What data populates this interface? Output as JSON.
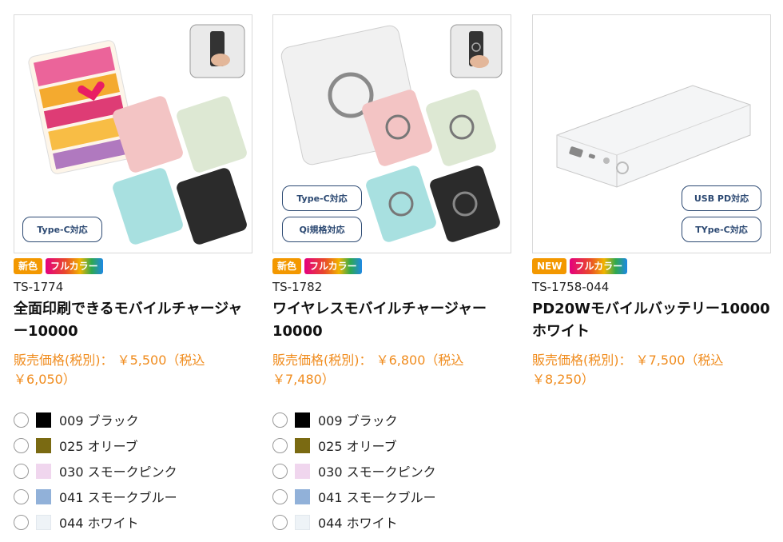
{
  "products": [
    {
      "badges": [
        "新色",
        "フルカラー"
      ],
      "code": "TS-1774",
      "title": "全面印刷できるモバイルチャージャー10000",
      "price": "販売価格(税別)： ￥5,500（税込￥6,050）",
      "tags": [
        "Type-C対応"
      ],
      "colors": [
        {
          "label": "009 ブラック",
          "hex": "#000000"
        },
        {
          "label": "025 オリーブ",
          "hex": "#7a6a12"
        },
        {
          "label": "030 スモークピンク",
          "hex": "#f0d6ee"
        },
        {
          "label": "041 スモークブルー",
          "hex": "#91b1d9"
        },
        {
          "label": "044 ホワイト",
          "hex": "#eef3f7"
        }
      ]
    },
    {
      "badges": [
        "新色",
        "フルカラー"
      ],
      "code": "TS-1782",
      "title": "ワイヤレスモバイルチャージャー10000",
      "price": "販売価格(税別)： ￥6,800（税込￥7,480）",
      "tags": [
        "Type-C対応",
        "Qi規格対応"
      ],
      "colors": [
        {
          "label": "009 ブラック",
          "hex": "#000000"
        },
        {
          "label": "025 オリーブ",
          "hex": "#7a6a12"
        },
        {
          "label": "030 スモークピンク",
          "hex": "#f0d6ee"
        },
        {
          "label": "041 スモークブルー",
          "hex": "#91b1d9"
        },
        {
          "label": "044 ホワイト",
          "hex": "#eef3f7"
        }
      ]
    },
    {
      "badges": [
        "NEW",
        "フルカラー"
      ],
      "code": "TS-1758-044",
      "title": "PD20Wモバイルバッテリー10000　ホワイト",
      "price": "販売価格(税別)： ￥7,500（税込￥8,250）",
      "tags": [
        "USB PD対応",
        "TYpe-C対応"
      ],
      "colors": []
    }
  ]
}
